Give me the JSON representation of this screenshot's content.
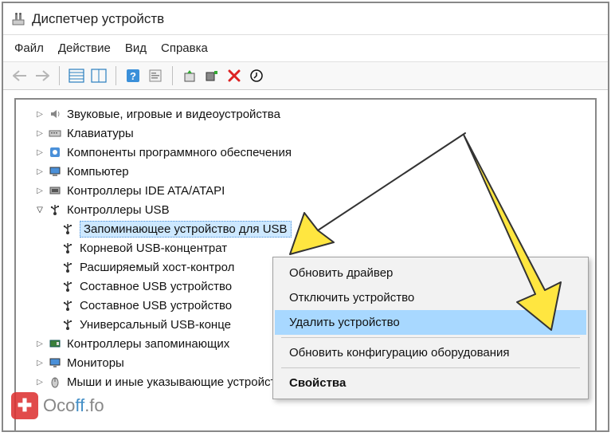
{
  "window": {
    "title": "Диспетчер устройств"
  },
  "menu": {
    "file": "Файл",
    "action": "Действие",
    "view": "Вид",
    "help": "Справка"
  },
  "tree": {
    "sound": "Звуковые, игровые и видеоустройства",
    "keyboards": "Клавиатуры",
    "software": "Компоненты программного обеспечения",
    "computer": "Компьютер",
    "ide": "Контроллеры IDE ATA/ATAPI",
    "usb": "Контроллеры USB",
    "usb_storage": "Запоминающее устройство для USB",
    "usb_roothub": "Корневой USB-концентрат",
    "usb_xhci": "Расширяемый хост-контрол",
    "usb_comp1": "Составное USB устройство",
    "usb_comp2": "Составное USB устройство",
    "usb_universal": "Универсальный USB-конце",
    "storage_ctrl": "Контроллеры запоминающих",
    "monitors": "Мониторы",
    "mice": "Мыши и иные указывающие устройства"
  },
  "context_menu": {
    "update": "Обновить драйвер",
    "disable": "Отключить устройство",
    "uninstall": "Удалить устройство",
    "scan": "Обновить конфигурацию оборудования",
    "properties": "Свойства"
  },
  "watermark": {
    "text1": "Oco",
    "text2": "ff",
    "text3": ".fo"
  }
}
